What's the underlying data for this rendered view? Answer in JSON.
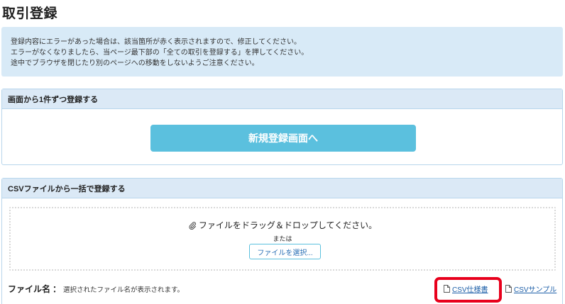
{
  "page": {
    "title": "取引登録"
  },
  "notice": {
    "lines": [
      "登録内容にエラーがあった場合は、該当箇所が赤く表示されますので、修正してください。",
      "エラーがなくなりましたら、当ページ最下部の「全ての取引を登録する」を押してください。",
      "途中でブラウザを閉じたり別のページへの移動をしないようご注意ください。"
    ]
  },
  "single_entry": {
    "heading": "画面から1件ずつ登録する",
    "button_label": "新規登録画面へ"
  },
  "csv_upload": {
    "heading": "CSVファイルから一括で登録する",
    "drop_text": "ファイルをドラッグ＆ドロップしてください。",
    "or_text": "または",
    "select_button_label": "ファイルを選択...",
    "file_label": "ファイル名",
    "file_colon": "：",
    "file_name_placeholder": "選択されたファイル名が表示されます。",
    "spec_link_label": "CSV仕様書",
    "sample_link_label": "CSVサンプル"
  },
  "colors": {
    "accent_button": "#5bc0de",
    "panel_header": "#dbe9f6",
    "notice_bg": "#d8eaf7",
    "link": "#1d5fa8",
    "highlight": "#e8001c"
  },
  "icons": {
    "drop": "paperclip-icon",
    "links": "document-icon"
  }
}
